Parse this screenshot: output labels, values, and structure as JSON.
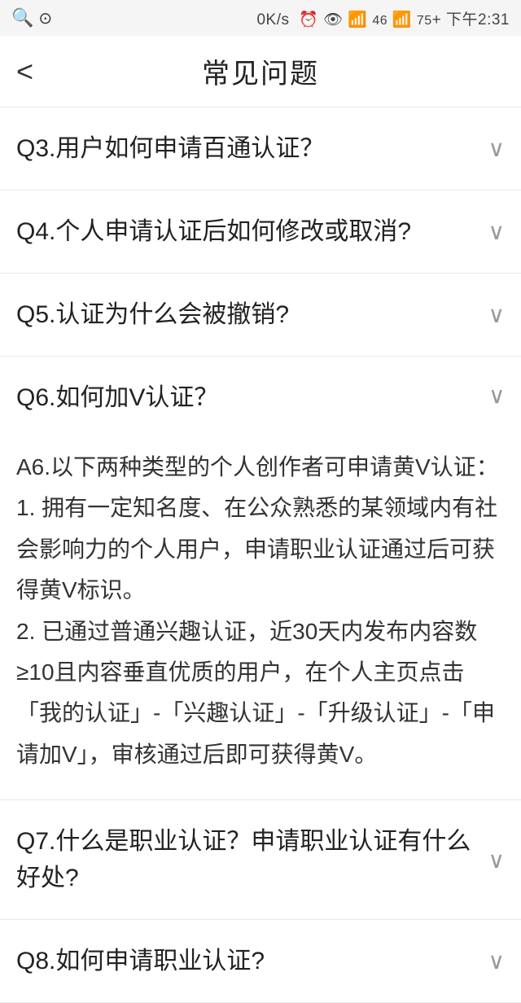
{
  "statusBar": {
    "left": {
      "search": "搜",
      "icon2": "⊙"
    },
    "center": "0K/s ⏰ 👁 ☁ 46↑↓ 75 +",
    "right": "下午2:31"
  },
  "nav": {
    "back_label": "‹",
    "title": "常见问题"
  },
  "faqs": [
    {
      "id": "q3",
      "question": "Q3.用户如何申请百通认证？",
      "answer": "",
      "expanded": false
    },
    {
      "id": "q4",
      "question": "Q4.个人申请认证后如何修改或取消?",
      "answer": "",
      "expanded": false
    },
    {
      "id": "q5",
      "question": "Q5.认证为什么会被撤销?",
      "answer": "",
      "expanded": false
    },
    {
      "id": "q6",
      "question": "Q6.如何加V认证？",
      "answer": "A6.以下两种类型的个人创作者可申请黄V认证：\n1. 拥有一定知名度、在公众熟悉的某领域内有社会影响力的个人用户，申请职业认证通过后可获得黄V标识。\n2. 已通过普通兴趣认证，近30天内发布内容数≥10且内容垂直优质的用户，在个人主页点击「我的认证」-「兴趣认证」-「升级认证」-「申请加V」，审核通过后即可获得黄V。",
      "expanded": true
    },
    {
      "id": "q7",
      "question": "Q7.什么是职业认证？申请职业认证有什么好处?",
      "answer": "",
      "expanded": false
    },
    {
      "id": "q8",
      "question": "Q8.如何申请职业认证?",
      "answer": "",
      "expanded": false
    }
  ]
}
